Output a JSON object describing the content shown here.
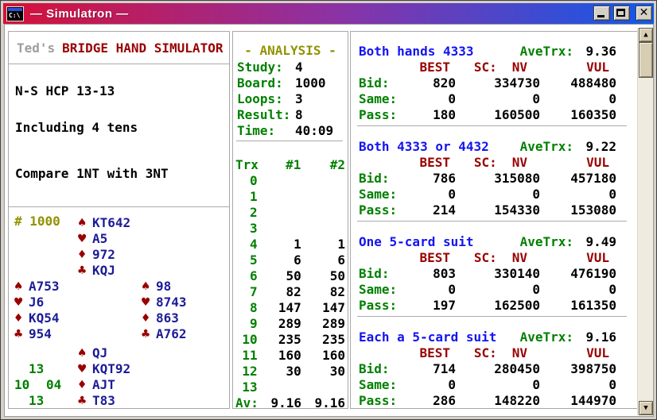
{
  "window": {
    "title": "— Simulatron —",
    "icon_text": "C:\\",
    "close_glyph": "✕"
  },
  "icons": {
    "spade": "♠",
    "heart": "♥",
    "diamond": "♦",
    "club": "♣",
    "up_arrow": "▲",
    "down_arrow": "▼"
  },
  "colors": {
    "titlebar_left": "#d81038",
    "titlebar_right": "#1159ea",
    "section_title_blue": "#1414f0",
    "label_green": "#008000",
    "header_maroon": "#990000",
    "olive": "#929200",
    "card_navy": "#1c1c96",
    "scrollbar_face": "#d7cdb3"
  },
  "left_panel": {
    "title_prefix": "Ted's",
    "title_main": "BRIDGE HAND SIMULATOR",
    "lines": [
      "N-S HCP 13-13",
      "Including 4 tens",
      "Compare 1NT with 3NT"
    ],
    "board_label": "# 1000",
    "hands": {
      "north": {
        "spades": "KT642",
        "hearts": "A5",
        "diamonds": "972",
        "clubs": "KQJ"
      },
      "west": {
        "spades": "A753",
        "hearts": "J6",
        "diamonds": "KQ54",
        "clubs": "954"
      },
      "east": {
        "spades": "98",
        "hearts": "8743",
        "diamonds": "863",
        "clubs": "A762"
      },
      "south": {
        "spades": "QJ",
        "hearts": "KQT92",
        "diamonds": "AJT",
        "clubs": "T83"
      }
    },
    "hcp": {
      "north": "13",
      "west": "10",
      "east": "04",
      "south": "13"
    }
  },
  "analysis": {
    "title": "- ANALYSIS -",
    "fields": [
      {
        "label": "Study:",
        "value": "4"
      },
      {
        "label": "Board:",
        "value": "1000"
      },
      {
        "label": "Loops:",
        "value": "3"
      },
      {
        "label": "Result:",
        "value": "8"
      },
      {
        "label": "Time:",
        "value": "40:09"
      }
    ],
    "table": {
      "col_labels": [
        "Trx",
        "#1",
        "#2"
      ],
      "rows": [
        [
          "0",
          "",
          ""
        ],
        [
          "1",
          "",
          ""
        ],
        [
          "2",
          "",
          ""
        ],
        [
          "3",
          "",
          ""
        ],
        [
          "4",
          "1",
          "1"
        ],
        [
          "5",
          "6",
          "6"
        ],
        [
          "6",
          "50",
          "50"
        ],
        [
          "7",
          "82",
          "82"
        ],
        [
          "8",
          "147",
          "147"
        ],
        [
          "9",
          "289",
          "289"
        ],
        [
          "10",
          "235",
          "235"
        ],
        [
          "11",
          "160",
          "160"
        ],
        [
          "12",
          "30",
          "30"
        ],
        [
          "13",
          "",
          ""
        ],
        [
          "Av:",
          "9.16",
          "9.16"
        ]
      ]
    }
  },
  "results": {
    "col_headers": [
      "BEST",
      "SC:",
      "NV",
      "VUL"
    ],
    "sections": [
      {
        "title": "Both hands 4333",
        "ave_label": "AveTrx:",
        "ave": "9.36",
        "rows": [
          [
            "Bid:",
            "820",
            "334730",
            "488480"
          ],
          [
            "Same:",
            "0",
            "0",
            "0"
          ],
          [
            "Pass:",
            "180",
            "160500",
            "160350"
          ]
        ]
      },
      {
        "title": "Both 4333 or 4432",
        "ave_label": "AveTrx:",
        "ave": "9.22",
        "rows": [
          [
            "Bid:",
            "786",
            "315080",
            "457180"
          ],
          [
            "Same:",
            "0",
            "0",
            "0"
          ],
          [
            "Pass:",
            "214",
            "154330",
            "153080"
          ]
        ]
      },
      {
        "title": "One 5-card suit",
        "ave_label": "AveTrx:",
        "ave": "9.49",
        "rows": [
          [
            "Bid:",
            "803",
            "330140",
            "476190"
          ],
          [
            "Same:",
            "0",
            "0",
            "0"
          ],
          [
            "Pass:",
            "197",
            "162500",
            "161350"
          ]
        ]
      },
      {
        "title": "Each a 5-card suit",
        "ave_label": "AveTrx:",
        "ave": "9.16",
        "rows": [
          [
            "Bid:",
            "714",
            "280450",
            "398750"
          ],
          [
            "Same:",
            "0",
            "0",
            "0"
          ],
          [
            "Pass:",
            "286",
            "148220",
            "144970"
          ]
        ]
      }
    ]
  }
}
